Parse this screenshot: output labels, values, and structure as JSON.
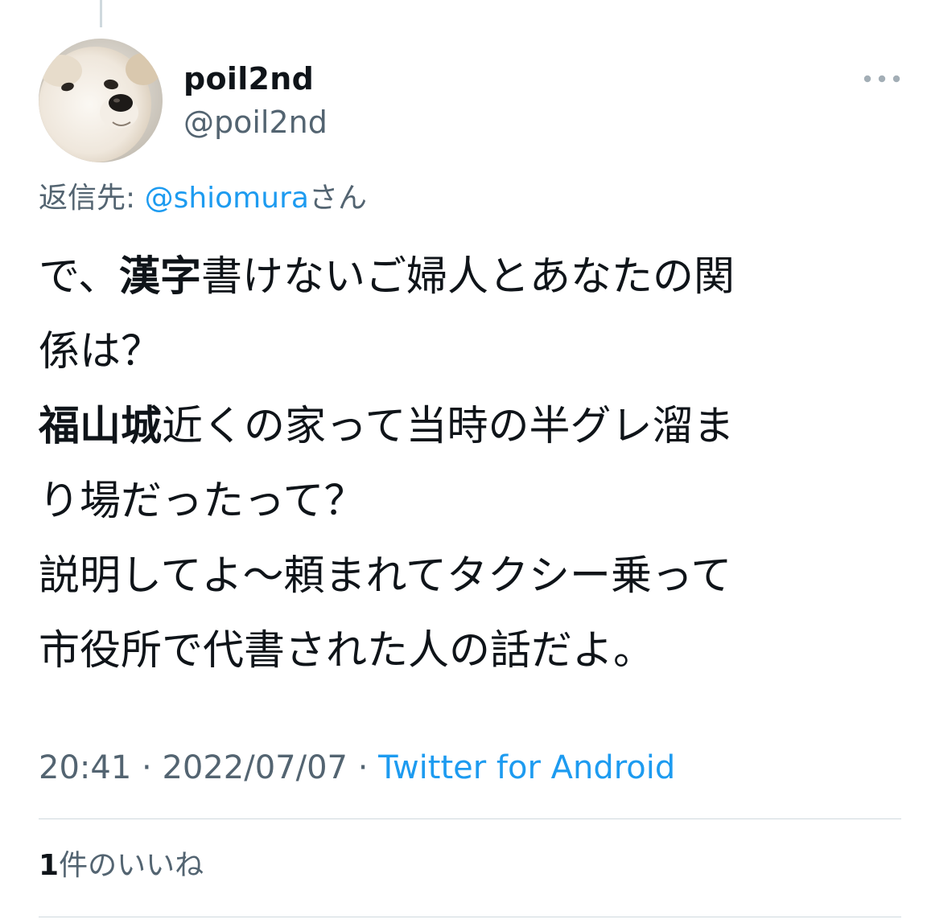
{
  "author": {
    "name": "poil2nd",
    "handle": "@poil2nd",
    "avatar_icon": "dog-avatar"
  },
  "more_icon": "more-horizontal-icon",
  "reply_context": {
    "prefix": "返信先: ",
    "mention": "@shiomura",
    "suffix": "さん"
  },
  "tweet": {
    "segments": [
      {
        "text": "で、",
        "bold": false
      },
      {
        "text": "漢字",
        "bold": true
      },
      {
        "text": "書けないご婦人とあなたの関",
        "bold": false
      },
      {
        "text": "係は？",
        "bold": false
      },
      {
        "text": "福山城",
        "bold": true
      },
      {
        "text": "近くの家って当時の半グレ溜ま",
        "bold": false
      },
      {
        "text": "り場だったって？",
        "bold": false
      },
      {
        "text": "説明してよ〜頼まれてタクシー乗って",
        "bold": false
      },
      {
        "text": "市役所で代書された人の話だよ。",
        "bold": false
      }
    ]
  },
  "meta": {
    "time": "20:41",
    "separator": " · ",
    "date": "2022/07/07",
    "source": "Twitter for Android"
  },
  "likes": {
    "count": "1",
    "label": "件のいいね"
  },
  "colors": {
    "text_primary": "#0f1419",
    "text_secondary": "#536471",
    "accent": "#1d9bf0",
    "divider": "#cfd9de"
  }
}
